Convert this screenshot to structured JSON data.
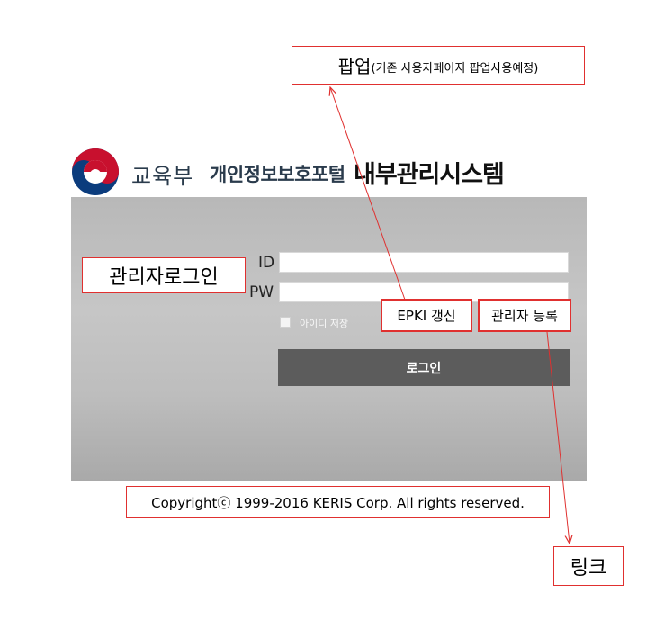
{
  "annotations": {
    "popup_title": "팝업",
    "popup_detail": "(기존 사용자페이지 팝업사용예정)",
    "admin_login": "관리자로그인",
    "epki_renew": "EPKI 갱신",
    "admin_register": "관리자 등록",
    "copyright": "Copyrightⓒ 1999-2016 KERIS Corp. All rights reserved.",
    "link": "링크"
  },
  "header": {
    "ministry": "교육부",
    "portal": "개인정보보호포털",
    "system": "내부관리시스템",
    "emblem_icon": "korea-government-taegeuk-emblem"
  },
  "login": {
    "id_label": "ID",
    "pw_label": "PW",
    "id_value": "",
    "pw_value": "",
    "remember_id_label": "아이디 저장",
    "remember_id_checked": false,
    "login_button": "로그인"
  },
  "colors": {
    "annotation_red": "#e0302f",
    "panel_gray": "#bdbdbd",
    "button_gray": "#5c5c5c",
    "emblem_red": "#c8102e",
    "emblem_blue": "#0b3c7d"
  }
}
